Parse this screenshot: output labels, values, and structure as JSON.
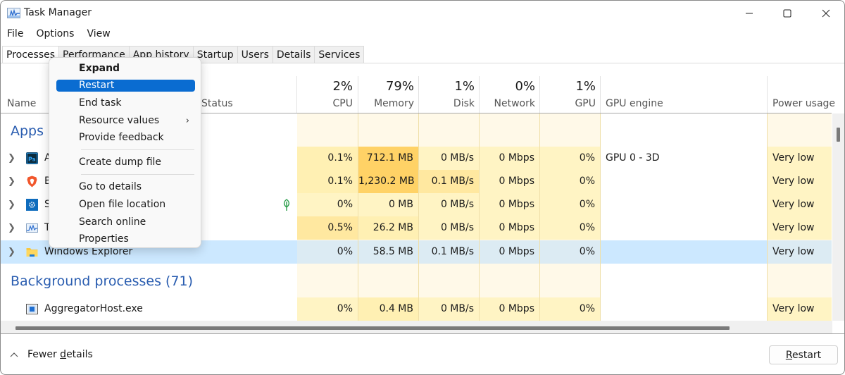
{
  "window": {
    "title": "Task Manager",
    "controls": [
      "minimize",
      "maximize",
      "close"
    ]
  },
  "menu": [
    "File",
    "Options",
    "View"
  ],
  "tabs": [
    {
      "label": "Processes",
      "active": true
    },
    {
      "label": "Performance"
    },
    {
      "label": "App history"
    },
    {
      "label": "Startup"
    },
    {
      "label": "Users"
    },
    {
      "label": "Details"
    },
    {
      "label": "Services"
    }
  ],
  "columns": {
    "name": "Name",
    "status": "Status",
    "cpu": {
      "pct": "2%",
      "label": "CPU"
    },
    "memory": {
      "pct": "79%",
      "label": "Memory"
    },
    "disk": {
      "pct": "1%",
      "label": "Disk"
    },
    "network": {
      "pct": "0%",
      "label": "Network"
    },
    "gpu": {
      "pct": "1%",
      "label": "GPU"
    },
    "gpu_engine": "GPU engine",
    "power": "Power usage"
  },
  "groups": {
    "apps": "Apps (",
    "background": "Background processes (71)"
  },
  "rows": [
    {
      "name": "A",
      "icon": "photoshop-icon",
      "status_icon": "",
      "cpu": "0.1%",
      "memory": "712.1 MB",
      "disk": "0 MB/s",
      "network": "0 Mbps",
      "gpu": "0%",
      "gpu_engine": "GPU 0 - 3D",
      "power": "Very low"
    },
    {
      "name": "B",
      "icon": "brave-icon",
      "status_icon": "",
      "cpu": "0.1%",
      "memory": "1,230.2 MB",
      "disk": "0.1 MB/s",
      "network": "0 Mbps",
      "gpu": "0%",
      "gpu_engine": "",
      "power": "Very low"
    },
    {
      "name": "S",
      "icon": "settings-icon",
      "status_icon": "leaf-icon",
      "cpu": "0%",
      "memory": "0 MB",
      "disk": "0 MB/s",
      "network": "0 Mbps",
      "gpu": "0%",
      "gpu_engine": "",
      "power": "Very low"
    },
    {
      "name": "T",
      "icon": "task-manager-icon",
      "status_icon": "",
      "cpu": "0.5%",
      "memory": "26.2 MB",
      "disk": "0 MB/s",
      "network": "0 Mbps",
      "gpu": "0%",
      "gpu_engine": "",
      "power": "Very low"
    },
    {
      "name": "Windows Explorer",
      "icon": "folder-icon",
      "status_icon": "",
      "cpu": "0%",
      "memory": "58.5 MB",
      "disk": "0.1 MB/s",
      "network": "0 Mbps",
      "gpu": "0%",
      "gpu_engine": "",
      "power": "Very low",
      "selected": true
    }
  ],
  "background_rows": [
    {
      "name": "AggregatorHost.exe",
      "icon": "app-window-icon",
      "cpu": "0%",
      "memory": "0.4 MB",
      "disk": "0 MB/s",
      "network": "0 Mbps",
      "gpu": "0%",
      "gpu_engine": "",
      "power": "Very low"
    }
  ],
  "context_menu": {
    "items": [
      {
        "label": "Expand",
        "bold": true
      },
      {
        "label": "Restart",
        "highlighted": true
      },
      {
        "label": "End task"
      },
      {
        "label": "Resource values",
        "submenu": true
      },
      {
        "label": "Provide feedback"
      },
      {
        "separator": true
      },
      {
        "label": "Create dump file"
      },
      {
        "separator": true
      },
      {
        "label": "Go to details"
      },
      {
        "label": "Open file location"
      },
      {
        "label": "Search online"
      },
      {
        "label": "Properties"
      }
    ],
    "submenu_arrow": "›"
  },
  "footer": {
    "fewer_details": "Fewer details",
    "fewer_details_pre": "Fewer ",
    "fewer_details_u": "d",
    "fewer_details_post": "etails",
    "restart_label": "Restart",
    "restart_u": "R",
    "restart_post": "estart"
  },
  "colors": {
    "accent": "#0a6cd1",
    "group_header": "#2a5db0",
    "selected_row": "#cce8ff",
    "heat_low": "#fff4c4",
    "heat_high": "#ffd266"
  }
}
